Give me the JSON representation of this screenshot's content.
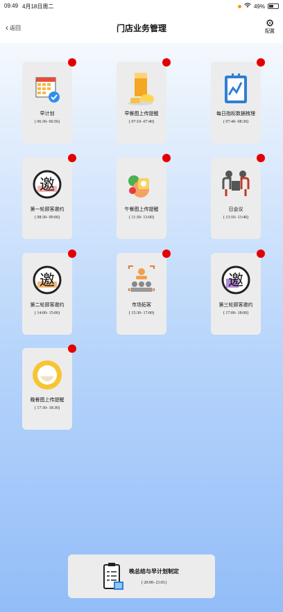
{
  "status_bar": {
    "time": "09:49",
    "date": "4月18日周二",
    "battery": "49%"
  },
  "nav": {
    "back_label": "返回",
    "title": "门店业务管理",
    "settings_label": "配置"
  },
  "cards": [
    {
      "label": "早计划",
      "time": "( 06:30- 06:50)",
      "icon": "calendar-check-icon"
    },
    {
      "label": "早餐图上传提醒",
      "time": "( 07:10- 07:40)",
      "icon": "breakfast-icon"
    },
    {
      "label": "每日指标数据梳理",
      "time": "( 07:40- 08:30)",
      "icon": "data-chart-icon"
    },
    {
      "label": "第一轮顾客邀约",
      "time": "( 08:30- 09:00)",
      "icon": "invite-icon"
    },
    {
      "label": "午餐图上传提醒",
      "time": "( 11:30- 13:00)",
      "icon": "lunch-icon"
    },
    {
      "label": "日会议",
      "time": "( 13:10- 13:40)",
      "icon": "meeting-icon"
    },
    {
      "label": "第二轮顾客邀约",
      "time": "( 14:00- 15:00)",
      "icon": "invite-icon"
    },
    {
      "label": "市场拓客",
      "time": "( 15:30- 17:00)",
      "icon": "market-icon"
    },
    {
      "label": "第三轮顾客邀约",
      "time": "( 17:00- 18:00)",
      "icon": "invite-icon"
    },
    {
      "label": "晚餐图上传提醒",
      "time": "( 17:30- 18:30)",
      "icon": "dinner-icon"
    }
  ],
  "invite_char": "邀",
  "evening": {
    "label": "晚总结与早计划制定",
    "time": "( 20:00- 21:01)",
    "icon": "summary-icon"
  },
  "colors": {
    "badge": "#e30000",
    "card": "#ececec",
    "accent_blue": "#2f7fd6"
  }
}
